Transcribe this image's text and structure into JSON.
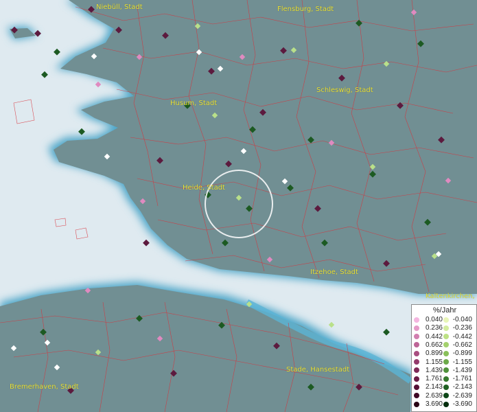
{
  "map": {
    "cities": [
      {
        "name": "Niebüll, Stadt"
      },
      {
        "name": "Flensburg, Stadt"
      },
      {
        "name": "Schleswig, Stadt"
      },
      {
        "name": "Husum, Stadt"
      },
      {
        "name": "Heide, Stadt"
      },
      {
        "name": "Itzehoe, Stadt"
      },
      {
        "name": "Kaltenkirchen, S"
      },
      {
        "name": "Stade, Hansestadt"
      },
      {
        "name": "Bremerhaven, Stadt"
      }
    ]
  },
  "legend": {
    "title": "%/Jahr",
    "positive": [
      {
        "value": "0.040",
        "color": "#f4b6e0"
      },
      {
        "value": "0.236",
        "color": "#e59ac8"
      },
      {
        "value": "0.442",
        "color": "#d27fb0"
      },
      {
        "value": "0.662",
        "color": "#bd6597"
      },
      {
        "value": "0.899",
        "color": "#a84e80"
      },
      {
        "value": "1.155",
        "color": "#933a6b"
      },
      {
        "value": "1.439",
        "color": "#7e2957"
      },
      {
        "value": "1.761",
        "color": "#6a1b45"
      },
      {
        "value": "2.143",
        "color": "#551034"
      },
      {
        "value": "2.639",
        "color": "#3f0824"
      },
      {
        "value": "3.690",
        "color": "#2a0315"
      }
    ],
    "negative": [
      {
        "value": "-0.040",
        "color": "#e8f5b8"
      },
      {
        "value": "-0.236",
        "color": "#d3ec9e"
      },
      {
        "value": "-0.442",
        "color": "#bde185"
      },
      {
        "value": "-0.662",
        "color": "#a4d16d"
      },
      {
        "value": "-0.899",
        "color": "#89c05a"
      },
      {
        "value": "-1.155",
        "color": "#6caa4a"
      },
      {
        "value": "-1.439",
        "color": "#4f923b"
      },
      {
        "value": "-1.761",
        "color": "#367a2e"
      },
      {
        "value": "-2.143",
        "color": "#206123"
      },
      {
        "value": "-2.639",
        "color": "#0e4718"
      },
      {
        "value": "-3.690",
        "color": "#042e0d"
      }
    ]
  }
}
